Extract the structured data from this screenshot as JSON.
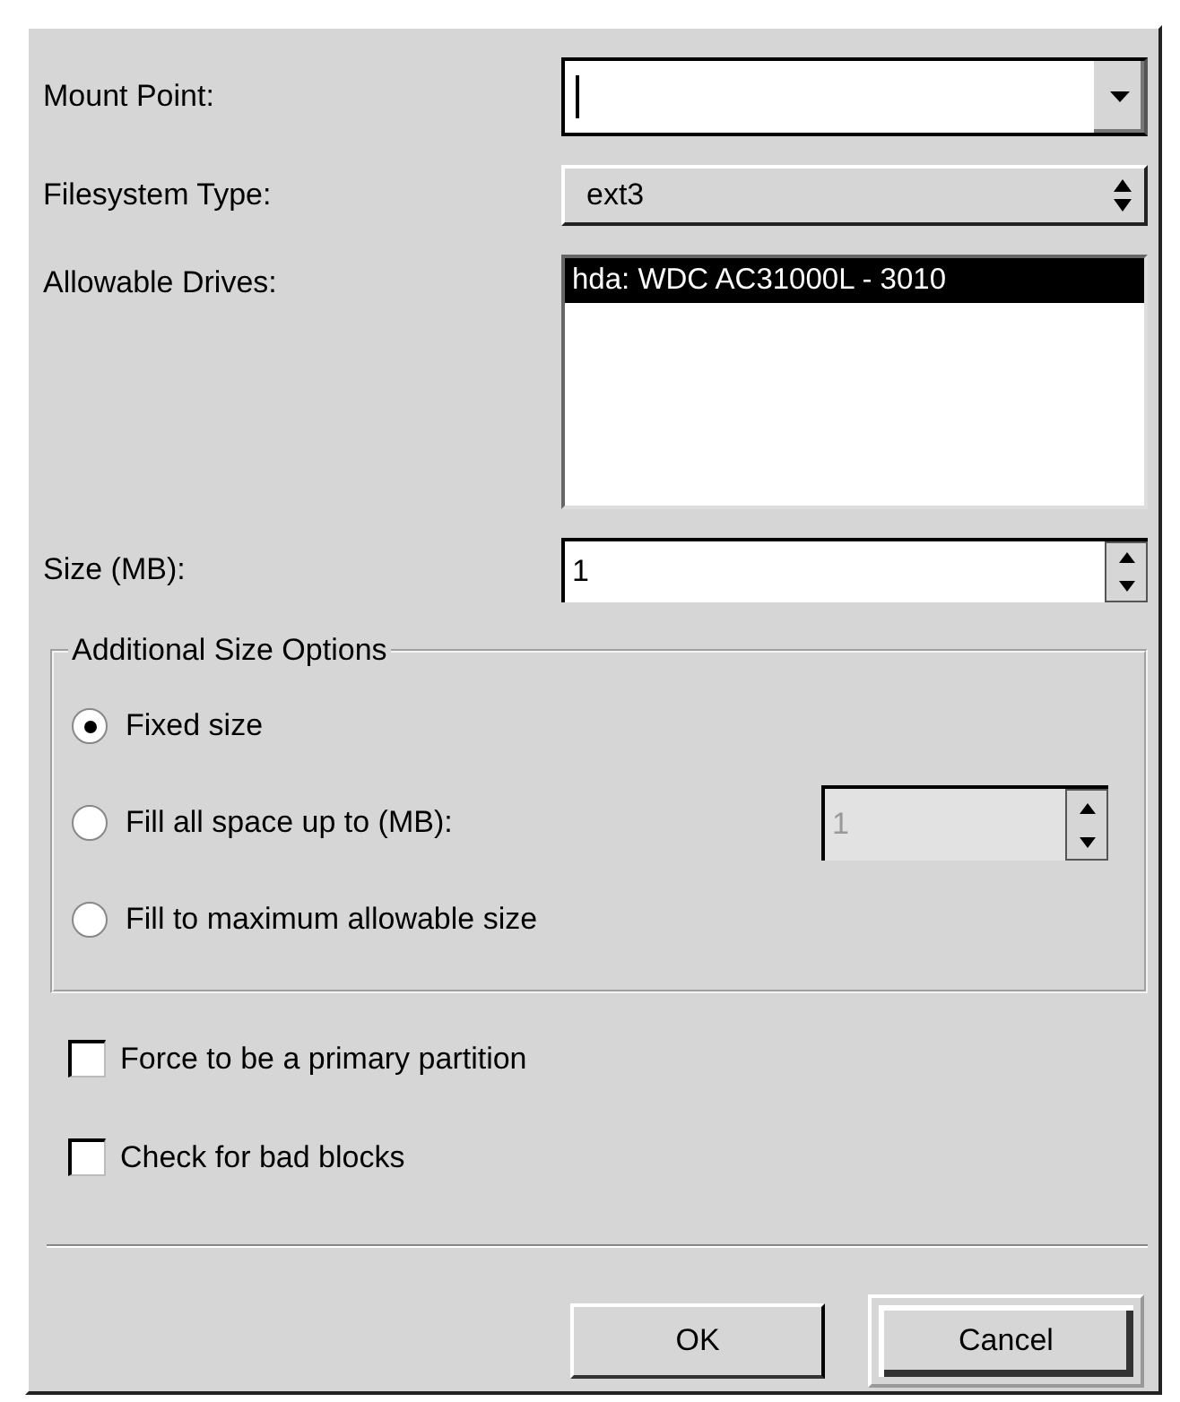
{
  "form": {
    "mount_point": {
      "label": "Mount Point:"
    },
    "filesystem_type": {
      "label": "Filesystem Type:",
      "value": "ext3"
    },
    "allowable_drives": {
      "label": "Allowable Drives:",
      "items": [
        {
          "text": "hda: WDC AC31000L - 3010",
          "selected": true
        }
      ]
    },
    "size": {
      "label": "Size (MB):",
      "value": "1"
    }
  },
  "size_options": {
    "title": "Additional Size Options",
    "options": [
      {
        "label": "Fixed size",
        "selected": true
      },
      {
        "label": "Fill all space up to (MB):",
        "selected": false,
        "value": "1",
        "disabled": true
      },
      {
        "label": "Fill to maximum allowable size",
        "selected": false
      }
    ]
  },
  "checkboxes": [
    {
      "label": "Force to be a primary partition",
      "checked": false
    },
    {
      "label": "Check for bad blocks",
      "checked": false
    }
  ],
  "buttons": [
    {
      "label": "OK",
      "default": false
    },
    {
      "label": "Cancel",
      "default": true
    }
  ]
}
